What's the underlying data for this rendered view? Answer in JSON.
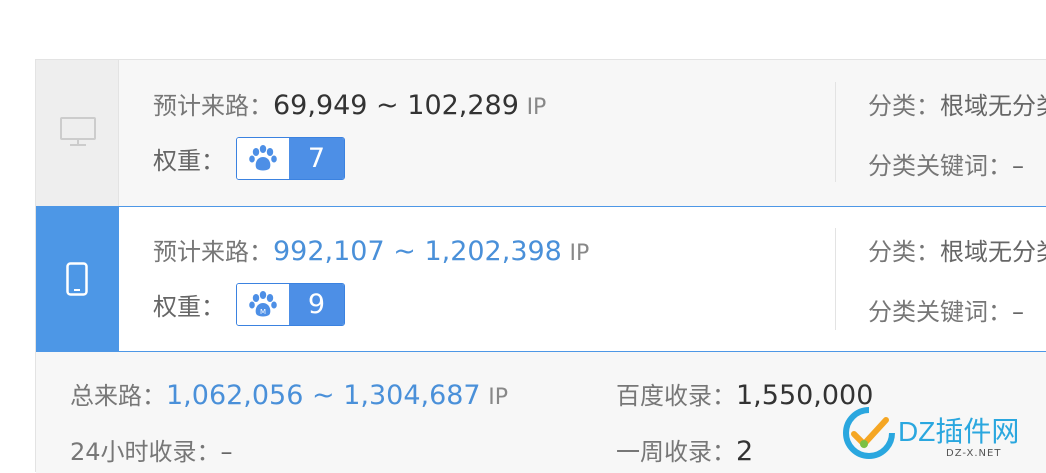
{
  "pc": {
    "traffic_label": "预计来路：",
    "traffic_value": "69,949 ~ 102,289",
    "traffic_unit": "IP",
    "weight_label": "权重：",
    "weight_value": "7",
    "category_label": "分类：",
    "category_value": "根域无分类",
    "keyword_label": "分类关键词：",
    "keyword_value": "–"
  },
  "mobile": {
    "traffic_label": "预计来路：",
    "traffic_value": "992,107 ~ 1,202,398",
    "traffic_unit": "IP",
    "weight_label": "权重：",
    "weight_value": "9",
    "category_label": "分类：",
    "category_value": "根域无分类",
    "keyword_label": "分类关键词：",
    "keyword_value": "–"
  },
  "summary": {
    "total_label": "总来路：",
    "total_value": "1,062,056 ~ 1,304,687",
    "total_unit": "IP",
    "baidu_label": "百度收录：",
    "baidu_value": "1,550,000",
    "day_label": "24小时收录：",
    "day_value": "–",
    "week_label": "一周收录：",
    "week_value": "2"
  },
  "watermark": {
    "text": "DZ插件网",
    "sub": "DZ-X.NET"
  },
  "colors": {
    "accent": "#4d97e6",
    "badge_blue": "#4d8fe6",
    "link_blue": "#4a90d9"
  },
  "icons": {
    "pc": "monitor-icon",
    "mobile": "phone-icon",
    "badge": "baidu-paw-icon"
  }
}
